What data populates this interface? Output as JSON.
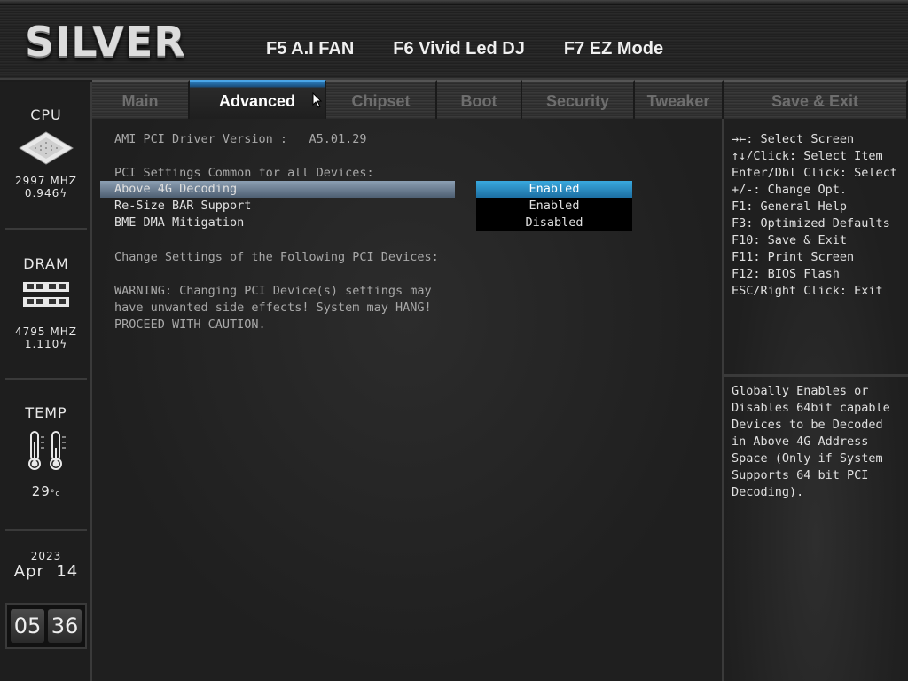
{
  "header": {
    "logo": "SILVER",
    "hotkeys": [
      "F5 A.I FAN",
      "F6 Vivid Led DJ",
      "F7 EZ Mode"
    ]
  },
  "sidebar": {
    "cpu": {
      "title": "CPU",
      "freq": "2997 MHZ",
      "volt": "0.946"
    },
    "dram": {
      "title": "DRAM",
      "freq": "4795 MHZ",
      "volt": "1.110"
    },
    "temp": {
      "title": "TEMP",
      "value": "29"
    },
    "date": {
      "year": "2023",
      "month": "Apr",
      "day": "14"
    },
    "clock": {
      "hour": "05",
      "minute": "36"
    }
  },
  "tabs": [
    "Main",
    "Advanced",
    "Chipset",
    "Boot",
    "Security",
    "Tweaker",
    "Save & Exit"
  ],
  "active_tab": "Advanced",
  "main": {
    "driver_label": "AMI PCI Driver Version :",
    "driver_value": "A5.01.29",
    "common_heading": "PCI Settings Common for all Devices:",
    "settings": [
      {
        "label": "Above 4G Decoding",
        "value": "Enabled"
      },
      {
        "label": "Re-Size BAR Support",
        "value": "Enabled"
      },
      {
        "label": "BME DMA Mitigation",
        "value": "Disabled"
      }
    ],
    "change_heading": "Change Settings of the Following PCI Devices:",
    "warning": [
      "WARNING: Changing PCI Device(s) settings may",
      "have unwanted side effects! System may HANG!",
      "PROCEED WITH CAUTION."
    ]
  },
  "help": [
    "→←: Select Screen",
    "↑↓/Click: Select Item",
    "Enter/Dbl Click: Select",
    "+/-: Change Opt.",
    "F1: General Help",
    "F3: Optimized Defaults",
    "F10: Save & Exit",
    "F11: Print Screen",
    "F12: BIOS Flash",
    "ESC/Right Click: Exit"
  ],
  "description": "Globally Enables or Disables 64bit capable Devices to be Decoded in Above 4G Address Space (Only if System Supports 64 bit PCI Decoding)."
}
